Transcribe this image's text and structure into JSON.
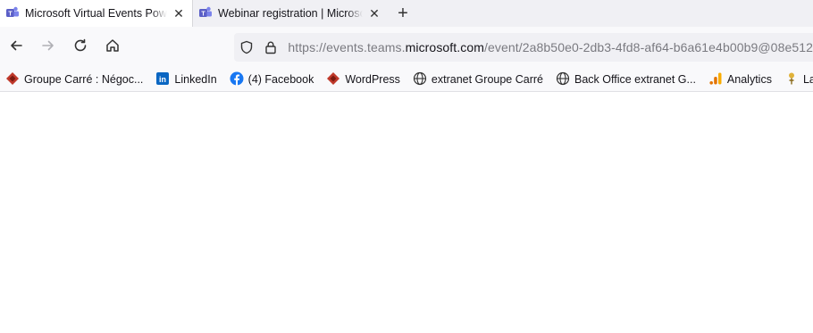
{
  "tabs": [
    {
      "title": "Microsoft Virtual Events Powered",
      "icon": "teams-icon",
      "active": true
    },
    {
      "title": "Webinar registration | Microsoft Teams",
      "icon": "teams-icon",
      "active": false
    }
  ],
  "navbar": {
    "url_prefix": "https://events.teams.",
    "url_host": "microsoft.com",
    "url_path": "/event/2a8b50e0-2db3-4fd8-af64-b6a61e4b00b9@08e512"
  },
  "bookmarks": [
    {
      "label": "Groupe Carré : Négoc...",
      "icon": "groupe-carre-icon"
    },
    {
      "label": "LinkedIn",
      "icon": "linkedin-icon"
    },
    {
      "label": "(4) Facebook",
      "icon": "facebook-icon"
    },
    {
      "label": "WordPress",
      "icon": "groupe-carre-icon"
    },
    {
      "label": "extranet Groupe Carré",
      "icon": "globe-icon"
    },
    {
      "label": "Back Office extranet G...",
      "icon": "globe-icon"
    },
    {
      "label": "Analytics",
      "icon": "analytics-icon"
    },
    {
      "label": "La conjugaison",
      "icon": "conjugaison-icon"
    }
  ],
  "colors": {
    "teams": "#5b5fc7",
    "linkedin": "#0a66c2",
    "facebook": "#1877f2",
    "groupe_carre": "#c0392b",
    "analytics_orange": "#f9ab00",
    "analytics_dark": "#e37400"
  }
}
